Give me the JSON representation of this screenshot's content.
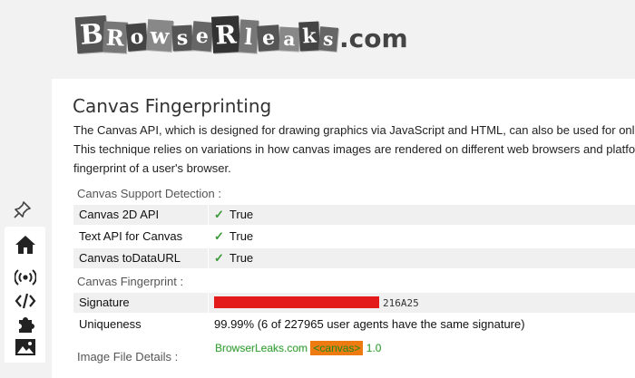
{
  "logo": {
    "text": "BrowserLeaks.com",
    "tiles": [
      "B",
      "R",
      "o",
      "w",
      "s",
      "e",
      "R",
      "l",
      "e",
      "a",
      "k",
      "s"
    ],
    "tail": ".com"
  },
  "page": {
    "title": "Canvas Fingerprinting",
    "description": [
      "The Canvas API, which is designed for drawing graphics via JavaScript and HTML, can also be used for online t",
      "This technique relies on variations in how canvas images are rendered on different web browsers and platforms",
      "fingerprint of a user's browser."
    ]
  },
  "support": {
    "label": "Canvas Support Detection :",
    "rows": [
      {
        "key": "Canvas 2D API",
        "value": "True"
      },
      {
        "key": "Text API for Canvas",
        "value": "True"
      },
      {
        "key": "Canvas toDataURL",
        "value": "True"
      }
    ],
    "check_glyph": "✓"
  },
  "fingerprint": {
    "label": "Canvas Fingerprint :",
    "signature_key": "Signature",
    "signature_tail": "216A25",
    "uniqueness_key": "Uniqueness",
    "uniqueness_value": "99.99% (6 of 227965 user agents have the same signature)"
  },
  "image_details": {
    "label": "Image File Details :",
    "site": "BrowserLeaks.com",
    "tag": "<canvas>",
    "version": "1.0"
  },
  "sidebar": {
    "icons": [
      "pin-icon",
      "home-icon",
      "broadcast-icon",
      "code-icon",
      "puzzle-icon",
      "image-icon"
    ]
  },
  "colors": {
    "signature_redaction": "#e31b1b",
    "check": "#3a9a3a",
    "canvas_tag_bg": "#ee7a12"
  }
}
